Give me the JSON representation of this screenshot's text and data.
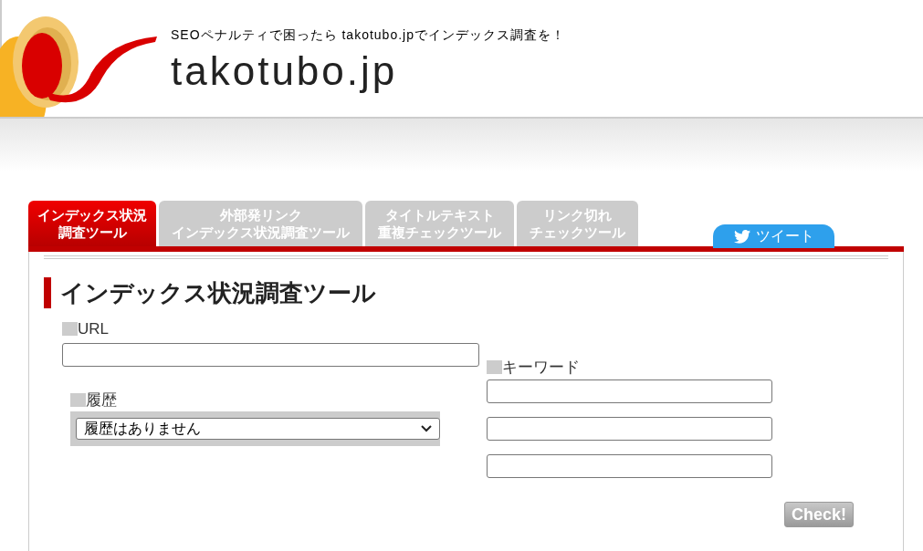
{
  "header": {
    "tagline": "SEOペナルティで困ったら takotubo.jpでインデックス調査を！",
    "site_title": "takotubo.jp"
  },
  "tabs": [
    {
      "lines": [
        "インデックス状況",
        "調査ツール"
      ],
      "selected": true
    },
    {
      "lines": [
        "外部発リンク",
        "インデックス状況調査ツール"
      ],
      "selected": false
    },
    {
      "lines": [
        "タイトルテキスト",
        "重複チェックツール"
      ],
      "selected": false
    },
    {
      "lines": [
        "リンク切れ",
        "チェックツール"
      ],
      "selected": false
    }
  ],
  "tweet_button": "ツイート",
  "form": {
    "heading": "インデックス状況調査ツール",
    "url_label": "URL",
    "history_label": "履歴",
    "history_value": "履歴はありません",
    "keyword_label": "キーワード",
    "submit": "Check!"
  }
}
